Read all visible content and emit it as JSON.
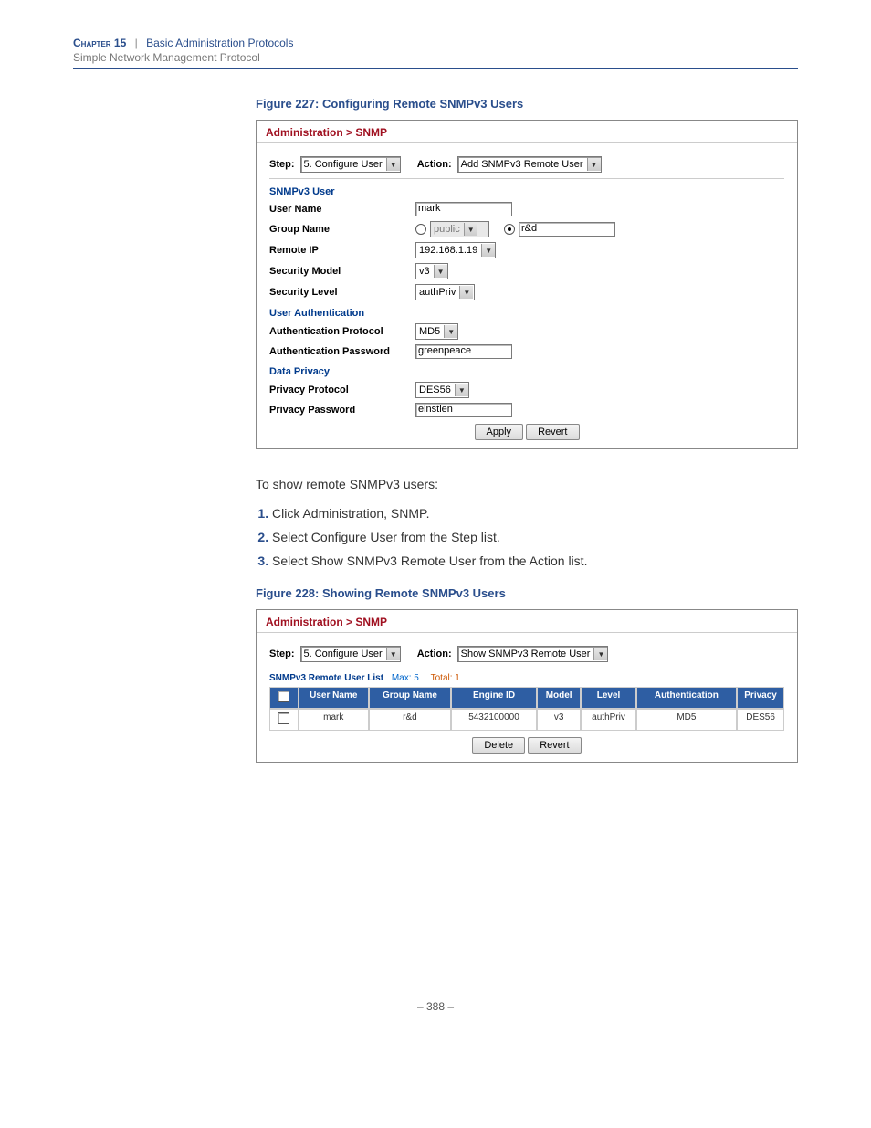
{
  "header": {
    "chapter": "Chapter 15",
    "sep": "|",
    "title": "Basic Administration Protocols",
    "subtitle": "Simple Network Management Protocol"
  },
  "fig227": {
    "caption": "Figure 227:  Configuring Remote SNMPv3 Users",
    "breadcrumb": "Administration > SNMP",
    "step_label": "Step:",
    "step_value": "5. Configure User",
    "action_label": "Action:",
    "action_value": "Add SNMPv3 Remote User",
    "section_user": "SNMPv3 User",
    "user_name_label": "User Name",
    "user_name_value": "mark",
    "group_name_label": "Group Name",
    "group_select_value": "public",
    "group_text_value": "r&d",
    "remote_ip_label": "Remote IP",
    "remote_ip_value": "192.168.1.19",
    "sec_model_label": "Security Model",
    "sec_model_value": "v3",
    "sec_level_label": "Security Level",
    "sec_level_value": "authPriv",
    "section_auth": "User Authentication",
    "auth_proto_label": "Authentication Protocol",
    "auth_proto_value": "MD5",
    "auth_pass_label": "Authentication Password",
    "auth_pass_value": "greenpeace",
    "section_priv": "Data Privacy",
    "priv_proto_label": "Privacy Protocol",
    "priv_proto_value": "DES56",
    "priv_pass_label": "Privacy Password",
    "priv_pass_value": "einstien",
    "apply": "Apply",
    "revert": "Revert"
  },
  "body_text": "To show remote SNMPv3 users:",
  "steps": [
    "Click Administration, SNMP.",
    "Select Configure User from the Step list.",
    "Select Show SNMPv3 Remote User from the Action list."
  ],
  "fig228": {
    "caption": "Figure 228:  Showing Remote SNMPv3 Users",
    "breadcrumb": "Administration > SNMP",
    "step_label": "Step:",
    "step_value": "5. Configure User",
    "action_label": "Action:",
    "action_value": "Show SNMPv3 Remote User",
    "list_title": "SNMPv3 Remote User List",
    "list_max": "Max: 5",
    "list_total": "Total: 1",
    "cols": {
      "user": "User Name",
      "group": "Group Name",
      "engine": "Engine ID",
      "model": "Model",
      "level": "Level",
      "auth": "Authentication",
      "priv": "Privacy"
    },
    "row": {
      "user": "mark",
      "group": "r&d",
      "engine": "5432100000",
      "model": "v3",
      "level": "authPriv",
      "auth": "MD5",
      "priv": "DES56"
    },
    "delete": "Delete",
    "revert": "Revert"
  },
  "page_number": "–  388  –"
}
